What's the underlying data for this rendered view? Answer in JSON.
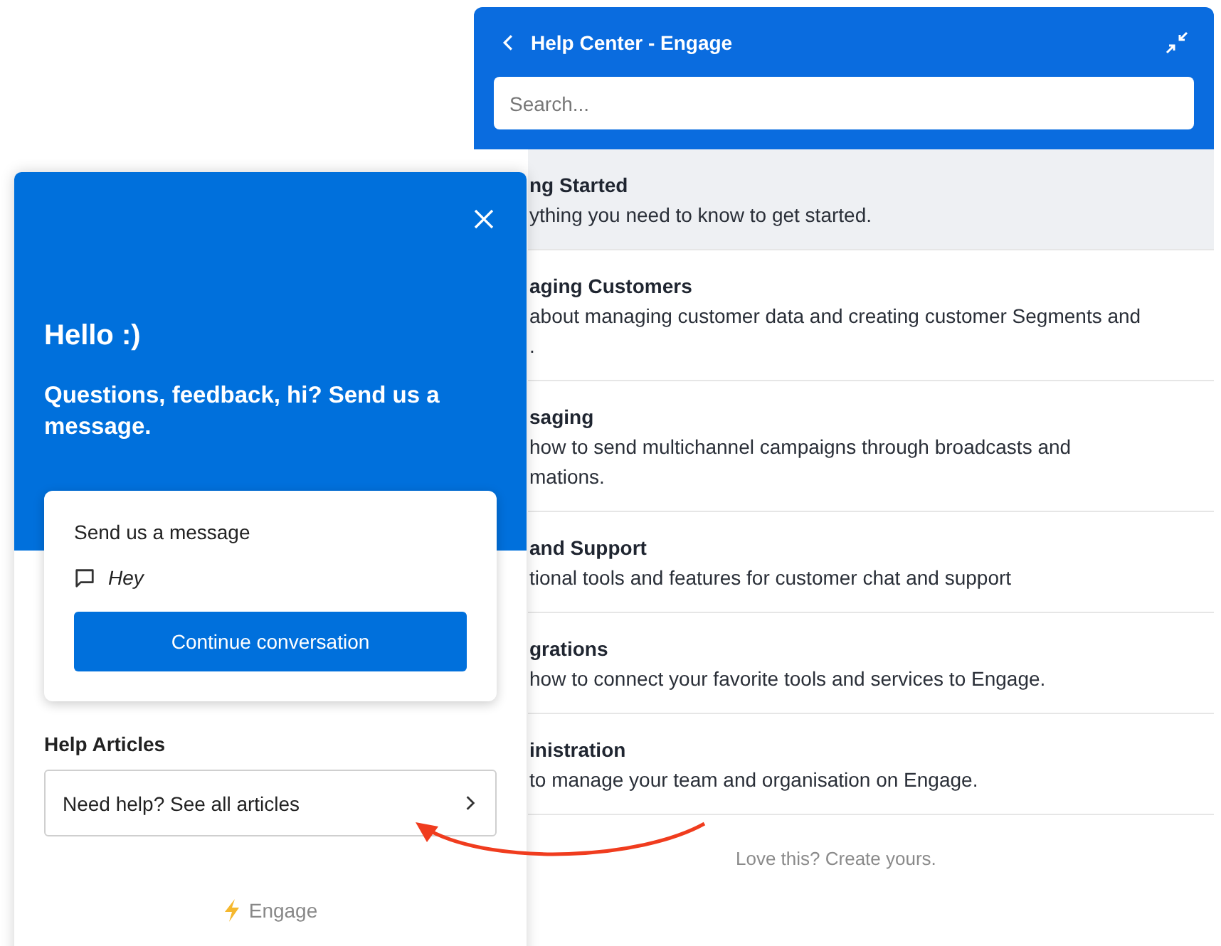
{
  "help_center": {
    "title": "Help Center - Engage",
    "search": {
      "placeholder": "Search..."
    },
    "categories": [
      {
        "title": "ng Started",
        "lines": [
          "ything you need to know to get started."
        ],
        "selected": true
      },
      {
        "title": "aging Customers",
        "lines": [
          "about managing customer data and creating customer Segments and",
          "."
        ],
        "selected": false
      },
      {
        "title": "saging",
        "lines": [
          "how to send multichannel campaigns through broadcasts and",
          "mations."
        ],
        "selected": false
      },
      {
        "title": "and Support",
        "lines": [
          "tional tools and features for customer chat and support"
        ],
        "selected": false
      },
      {
        "title": "grations",
        "lines": [
          "how to connect your favorite tools and services to Engage."
        ],
        "selected": false
      },
      {
        "title": "inistration",
        "lines": [
          "to manage your team and organisation on Engage."
        ],
        "selected": false
      }
    ],
    "footer": "Love this? Create yours."
  },
  "widget": {
    "greeting": "Hello :)",
    "subtitle": "Questions, feedback, hi? Send us a message.",
    "conversation": {
      "heading": "Send us a message",
      "last_message": "Hey",
      "button": "Continue conversation"
    },
    "articles": {
      "heading": "Help Articles",
      "link": "Need help? See all articles"
    },
    "brand": "Engage"
  }
}
